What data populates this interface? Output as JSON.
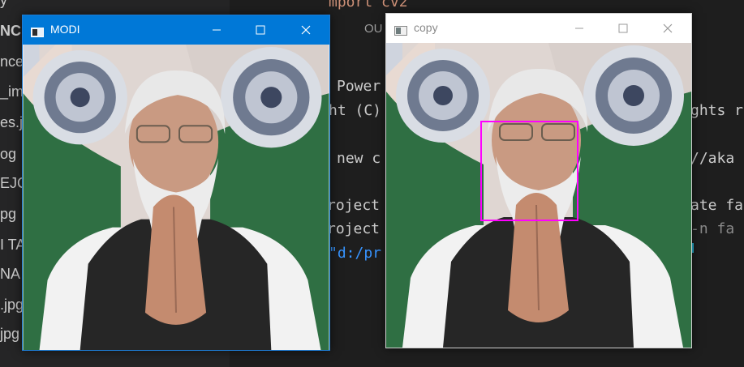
{
  "sidebar": {
    "items": [
      "y",
      "NCI",
      "nce",
      "_im",
      "es.j",
      "og",
      "EJC",
      "pg",
      "I TA",
      "NA",
      ".jpg",
      "jpg"
    ]
  },
  "editor": {
    "code_top": "mport cv2",
    "panel_tab": "OU",
    "terminal": {
      "l1": "Power",
      "l2": "ht (C)",
      "l2b": "ghts r",
      "l3": "new c",
      "l3b": "//aka",
      "l4": "roject",
      "l4b": "ate fa",
      "l5": "roject",
      "l5b": "-n fa",
      "l6": "\"d:/pr"
    }
  },
  "windows": {
    "modi": {
      "title": "MODI",
      "active": true
    },
    "copy": {
      "title": "copy",
      "active": false
    }
  },
  "colors": {
    "active_titlebar": "#0078d7",
    "face_box": "#ff00ff"
  },
  "icons": [
    "app-icon",
    "minimize-icon",
    "maximize-icon",
    "close-icon"
  ]
}
